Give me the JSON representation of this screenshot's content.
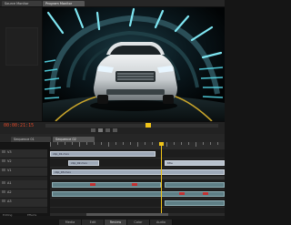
{
  "monitor": {
    "tabs": [
      {
        "label": "Source Monitor"
      },
      {
        "label": "Program Monitor"
      }
    ]
  },
  "timecode": "00:00:21:15",
  "timeline": {
    "tabs": [
      {
        "label": "Sequence 01"
      },
      {
        "label": "Sequence 02"
      }
    ],
    "tracks": [
      {
        "label": "V3"
      },
      {
        "label": "V2"
      },
      {
        "label": "V1"
      },
      {
        "label": "A1"
      },
      {
        "label": "A2"
      },
      {
        "label": "A3"
      }
    ],
    "clips": [
      {
        "label": "clip_01.mov"
      },
      {
        "label": "clip_02.mov"
      },
      {
        "label": "title"
      },
      {
        "label": "clip_03.mov"
      }
    ]
  },
  "status": {
    "left": "Editing",
    "mid": "Effects"
  },
  "bottom_tabs": [
    {
      "label": "Media"
    },
    {
      "label": "Edit"
    },
    {
      "label": "Review"
    },
    {
      "label": "Color"
    },
    {
      "label": "Audio"
    }
  ],
  "colors": {
    "timecode": "#e0492a",
    "playhead": "#f0c419",
    "clip_video": "#9ea9b8",
    "clip_audio": "#5f7f86",
    "marker": "#c23030",
    "tunnel_light": "#55d8e8"
  }
}
